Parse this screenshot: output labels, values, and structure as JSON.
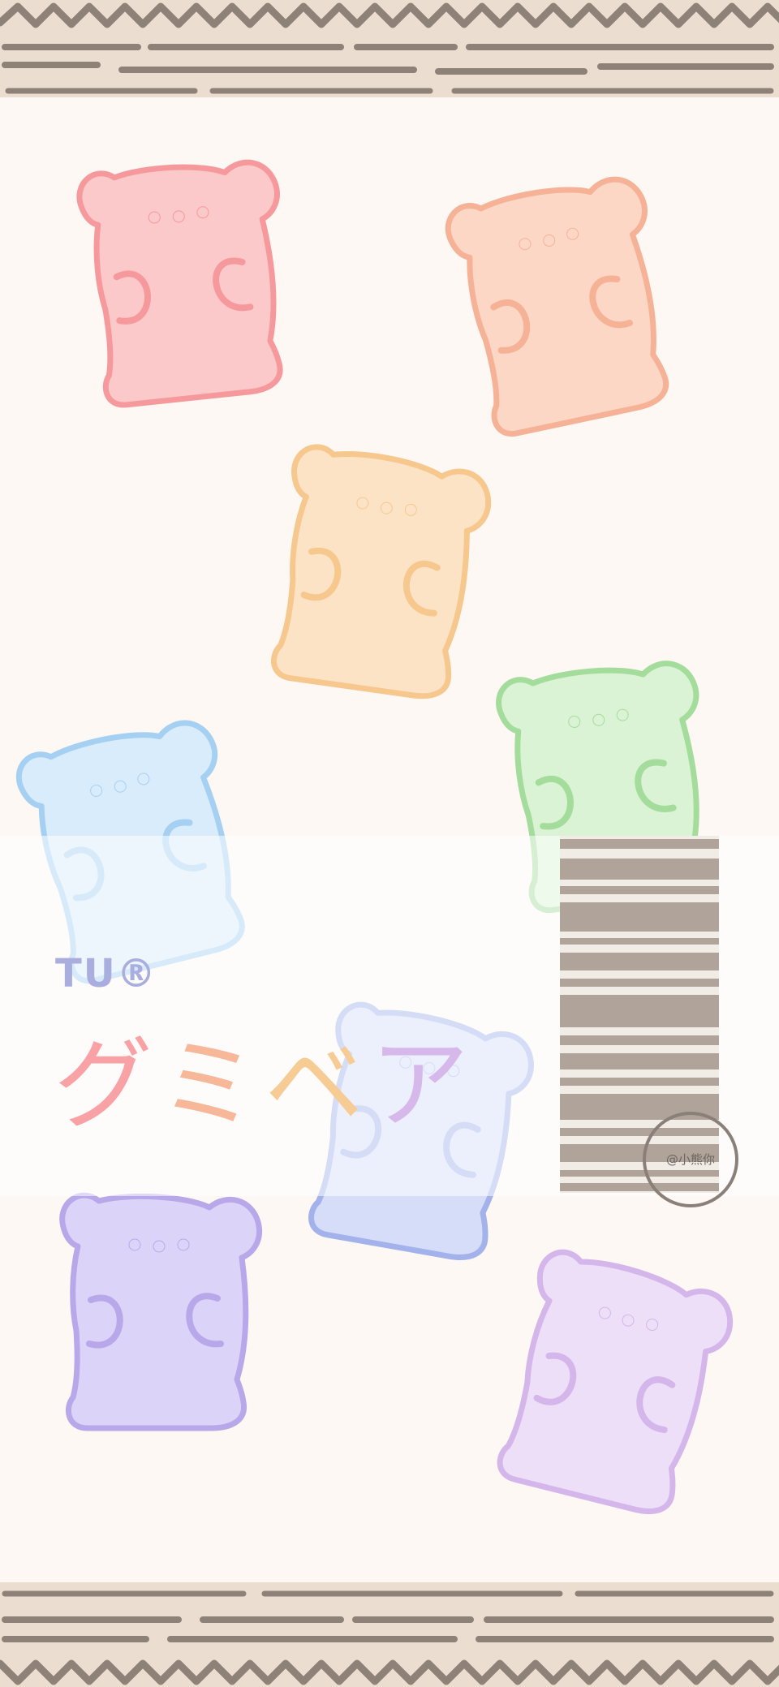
{
  "wallpaper": {
    "logo": {
      "small": "TU®",
      "title": "グミベア"
    },
    "stamp_label": "@小熊你"
  },
  "colors": {
    "background": "#fdf8f4",
    "border_tan": "#e8d8c8",
    "border_line": "#8e8278",
    "bear_red": "#f8a2a6",
    "bear_orange": "#f7b89a",
    "bear_yellow": "#f7cb94",
    "bear_green": "#a9dfa0",
    "bear_blue": "#a8d2f2",
    "bear_periwinkle": "#a8b6ea",
    "bear_purple": "#c1b2ec",
    "bear_lilac": "#d7b8ea",
    "barcode": "#b0a39a"
  },
  "bears": [
    {
      "name": "red"
    },
    {
      "name": "orange"
    },
    {
      "name": "yellow"
    },
    {
      "name": "green"
    },
    {
      "name": "blue"
    },
    {
      "name": "periwinkle"
    },
    {
      "name": "purple"
    },
    {
      "name": "lilac"
    }
  ]
}
